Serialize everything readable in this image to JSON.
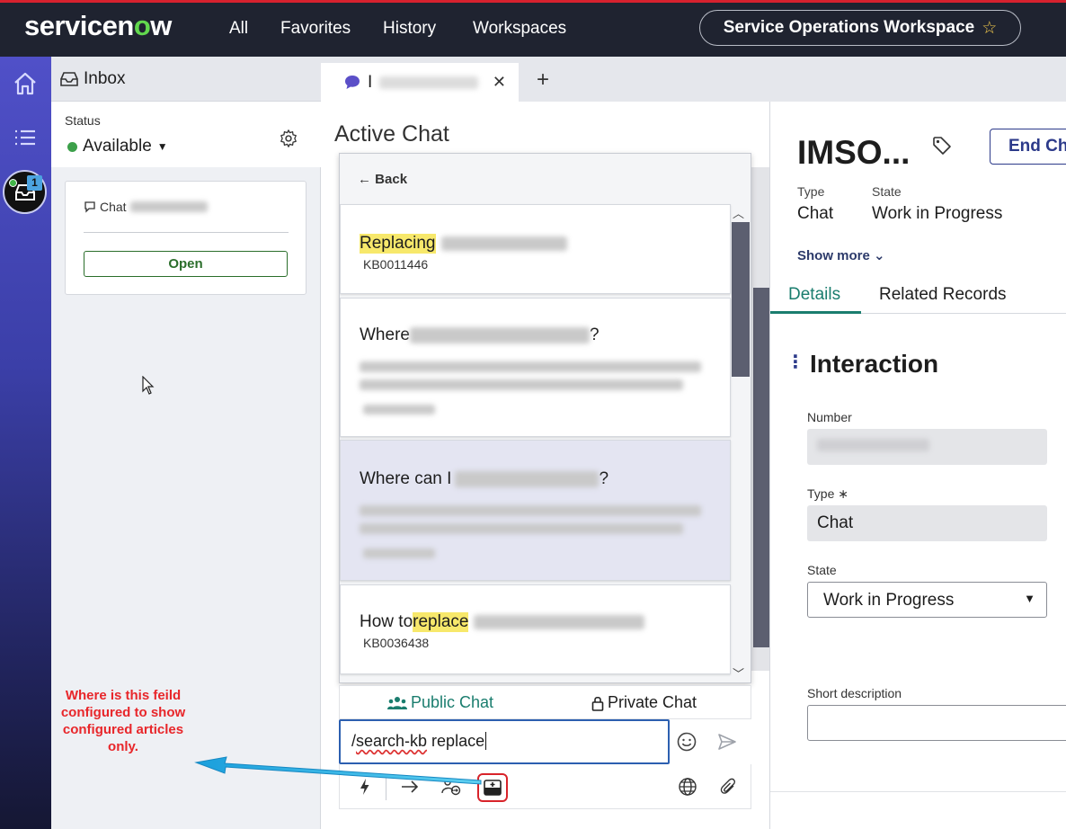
{
  "topbar": {
    "logo_prefix": "servicen",
    "logo_o": "o",
    "logo_suffix": "w",
    "nav": [
      "All",
      "Favorites",
      "History",
      "Workspaces"
    ],
    "workspace": "Service Operations Workspace",
    "accent_red": "#d6212e",
    "logo_green": "#62d84e"
  },
  "rail": {
    "icons": [
      "home-icon",
      "list-icon",
      "inbox-icon"
    ],
    "inbox_count": "1"
  },
  "inbox": {
    "title": "Inbox",
    "status_label": "Status",
    "status_value": "Available",
    "chat_label": "Chat",
    "open_button": "Open"
  },
  "tabs": {
    "active_tab_prefix": "I",
    "add": "+"
  },
  "chat": {
    "title": "Active Chat",
    "back": "Back",
    "kb_items": [
      {
        "title_highlight": "Replacing",
        "number": "KB0011446"
      },
      {
        "title_before": "Where ",
        "title_mid": "can I",
        "title_after": "?"
      },
      {
        "title_before": "Where can I",
        "title_after": "?"
      },
      {
        "title_before": "How to ",
        "title_highlight": "replace",
        "number": "KB0036438"
      }
    ],
    "public_chat": "Public Chat",
    "private_chat": "Private Chat",
    "input_prefix": "/",
    "input_squiggle": "search-kb",
    "input_suffix": " replace"
  },
  "record": {
    "title": "IMSO...",
    "end_button": "End Ch",
    "type_label": "Type",
    "type_value": "Chat",
    "state_label": "State",
    "state_value": "Work in Progress",
    "show_more": "Show more",
    "tabs": [
      "Details",
      "Related Records"
    ],
    "section": "Interaction",
    "fields": {
      "number_label": "Number",
      "type_label": "Type",
      "type_required": "∗",
      "type_value": "Chat",
      "state_label": "State",
      "state_value": "Work in Progress",
      "short_desc_label": "Short description"
    }
  },
  "annotation": {
    "text": "Where is this feild configured to show configured articles only."
  }
}
